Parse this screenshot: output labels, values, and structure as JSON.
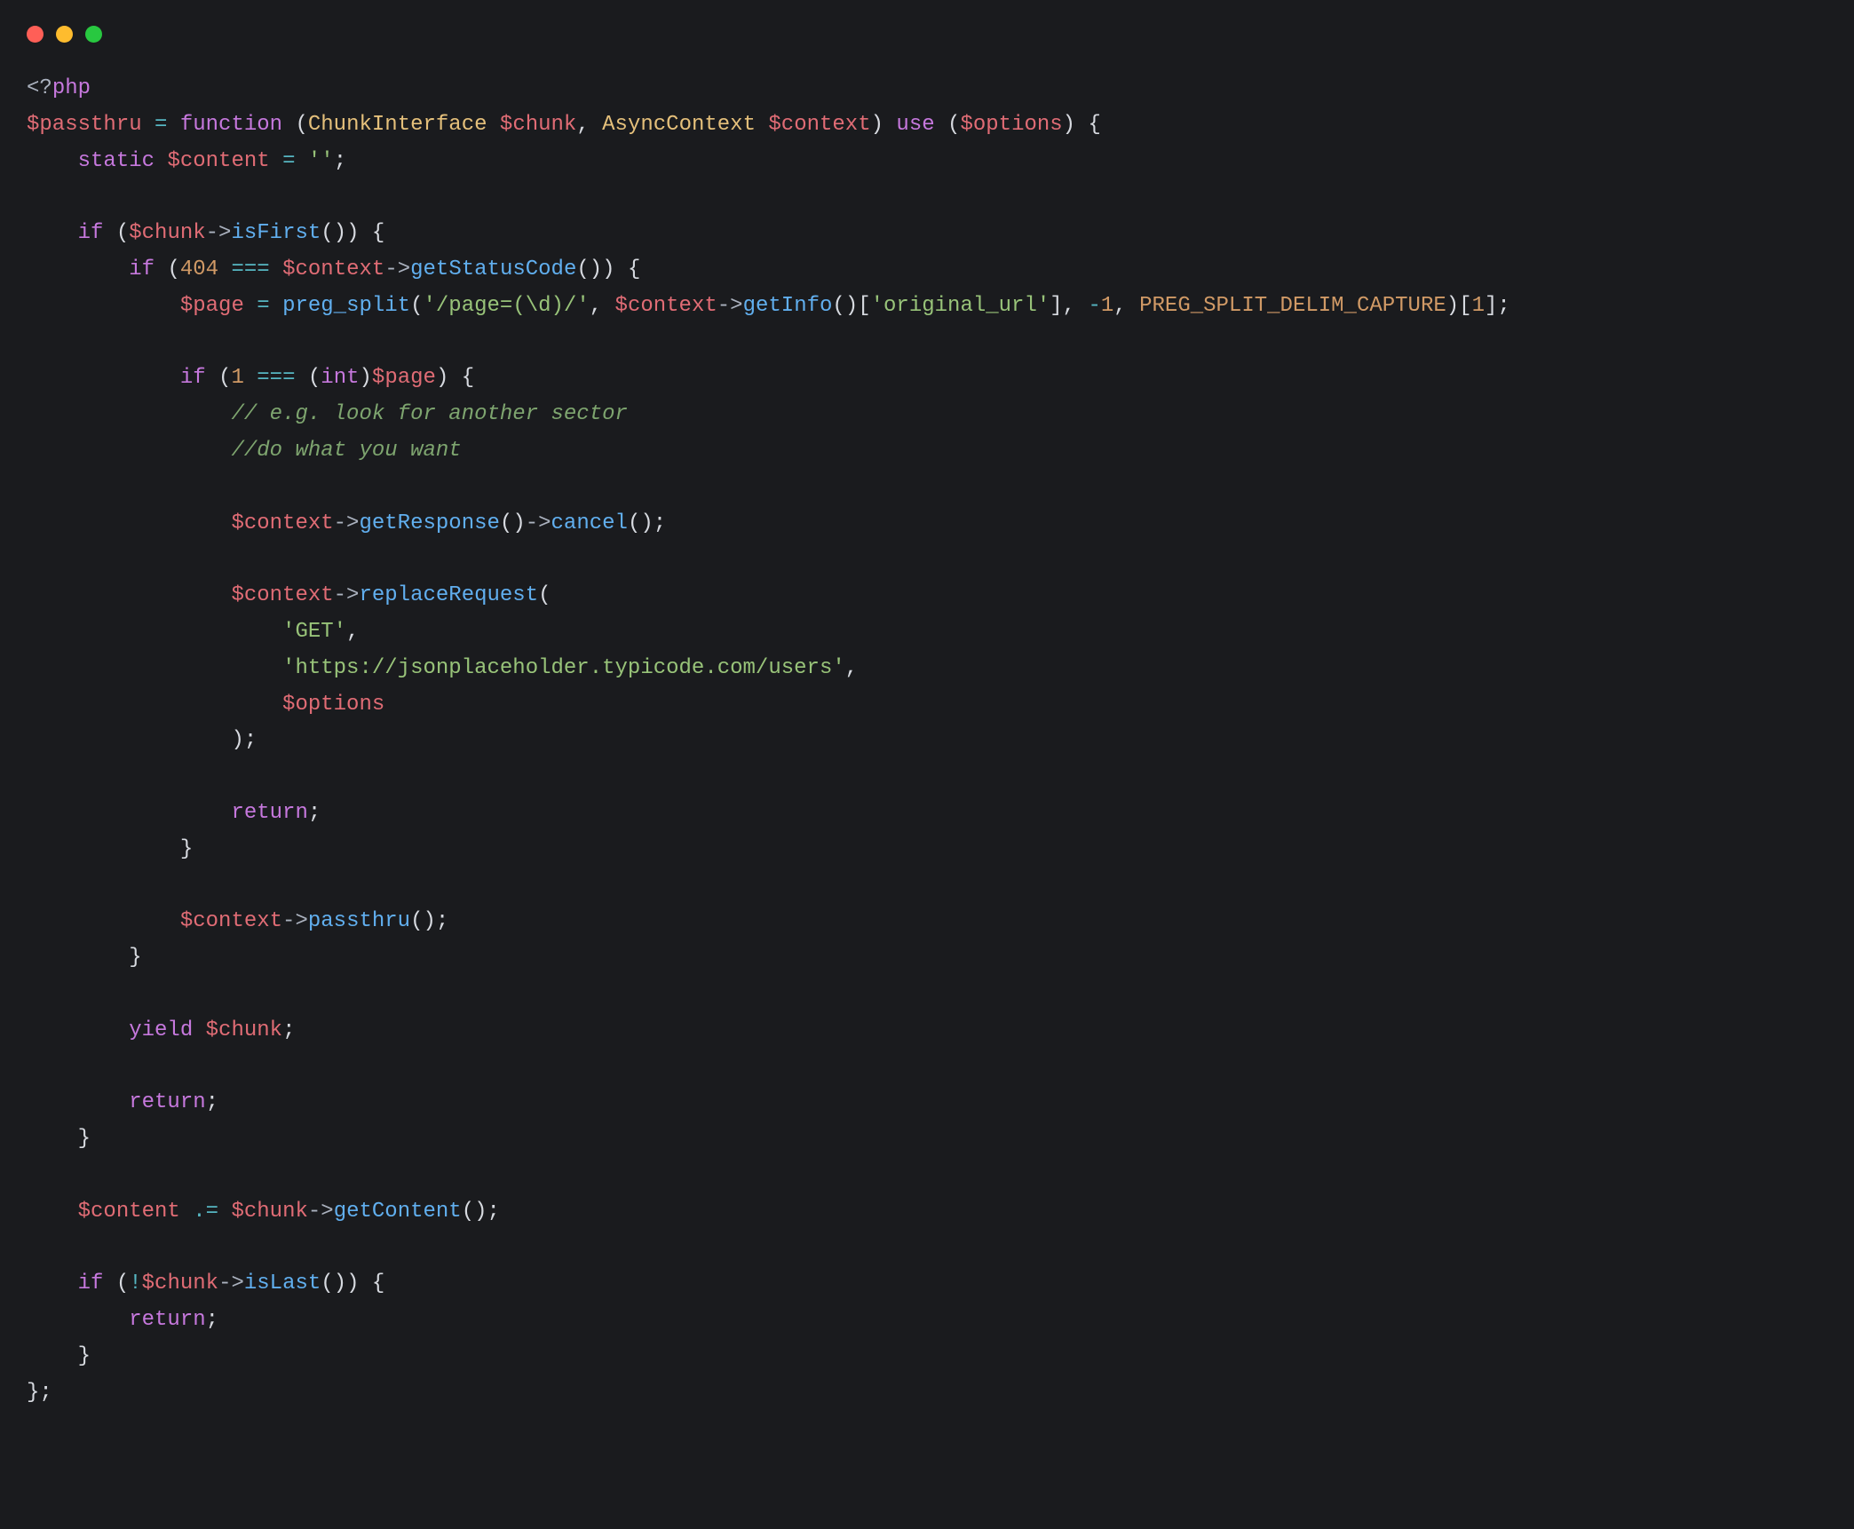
{
  "titlebar": {
    "dots": {
      "red": "#ff5f57",
      "yellow": "#febc2e",
      "green": "#28c840"
    }
  },
  "code": {
    "language": "php",
    "tokens": [
      [
        [
          "t-tag",
          "<?"
        ],
        [
          "t-kw",
          "php"
        ]
      ],
      [
        [
          "t-var",
          "$passthru"
        ],
        [
          "t-misc",
          " "
        ],
        [
          "t-op",
          "="
        ],
        [
          "t-misc",
          " "
        ],
        [
          "t-kw",
          "function"
        ],
        [
          "t-misc",
          " "
        ],
        [
          "t-punct",
          "("
        ],
        [
          "t-type",
          "ChunkInterface"
        ],
        [
          "t-misc",
          " "
        ],
        [
          "t-var",
          "$chunk"
        ],
        [
          "t-punct",
          ","
        ],
        [
          "t-misc",
          " "
        ],
        [
          "t-type",
          "AsyncContext"
        ],
        [
          "t-misc",
          " "
        ],
        [
          "t-var",
          "$context"
        ],
        [
          "t-punct",
          ")"
        ],
        [
          "t-misc",
          " "
        ],
        [
          "t-kw",
          "use"
        ],
        [
          "t-misc",
          " "
        ],
        [
          "t-punct",
          "("
        ],
        [
          "t-var",
          "$options"
        ],
        [
          "t-punct",
          ")"
        ],
        [
          "t-misc",
          " "
        ],
        [
          "t-punct",
          "{"
        ]
      ],
      [
        [
          "t-misc",
          "    "
        ],
        [
          "t-kw",
          "static"
        ],
        [
          "t-misc",
          " "
        ],
        [
          "t-var",
          "$content"
        ],
        [
          "t-misc",
          " "
        ],
        [
          "t-op",
          "="
        ],
        [
          "t-misc",
          " "
        ],
        [
          "t-str",
          "''"
        ],
        [
          "t-punct",
          ";"
        ]
      ],
      [],
      [
        [
          "t-misc",
          "    "
        ],
        [
          "t-kw",
          "if"
        ],
        [
          "t-misc",
          " "
        ],
        [
          "t-punct",
          "("
        ],
        [
          "t-var",
          "$chunk"
        ],
        [
          "t-arrow",
          "->"
        ],
        [
          "t-func",
          "isFirst"
        ],
        [
          "t-punct",
          "("
        ],
        [
          "t-punct",
          ")"
        ],
        [
          "t-punct",
          ")"
        ],
        [
          "t-misc",
          " "
        ],
        [
          "t-punct",
          "{"
        ]
      ],
      [
        [
          "t-misc",
          "        "
        ],
        [
          "t-kw",
          "if"
        ],
        [
          "t-misc",
          " "
        ],
        [
          "t-punct",
          "("
        ],
        [
          "t-num",
          "404"
        ],
        [
          "t-misc",
          " "
        ],
        [
          "t-op",
          "==="
        ],
        [
          "t-misc",
          " "
        ],
        [
          "t-var",
          "$context"
        ],
        [
          "t-arrow",
          "->"
        ],
        [
          "t-func",
          "getStatusCode"
        ],
        [
          "t-punct",
          "("
        ],
        [
          "t-punct",
          ")"
        ],
        [
          "t-punct",
          ")"
        ],
        [
          "t-misc",
          " "
        ],
        [
          "t-punct",
          "{"
        ]
      ],
      [
        [
          "t-misc",
          "            "
        ],
        [
          "t-var",
          "$page"
        ],
        [
          "t-misc",
          " "
        ],
        [
          "t-op",
          "="
        ],
        [
          "t-misc",
          " "
        ],
        [
          "t-func",
          "preg_split"
        ],
        [
          "t-punct",
          "("
        ],
        [
          "t-str",
          "'/page=(\\d)/'"
        ],
        [
          "t-punct",
          ","
        ],
        [
          "t-misc",
          " "
        ],
        [
          "t-var",
          "$context"
        ],
        [
          "t-arrow",
          "->"
        ],
        [
          "t-func",
          "getInfo"
        ],
        [
          "t-punct",
          "("
        ],
        [
          "t-punct",
          ")"
        ],
        [
          "t-punct",
          "["
        ],
        [
          "t-str",
          "'original_url'"
        ],
        [
          "t-punct",
          "]"
        ],
        [
          "t-punct",
          ","
        ],
        [
          "t-misc",
          " "
        ],
        [
          "t-op",
          "-"
        ],
        [
          "t-num",
          "1"
        ],
        [
          "t-punct",
          ","
        ],
        [
          "t-misc",
          " "
        ],
        [
          "t-const",
          "PREG_SPLIT_DELIM_CAPTURE"
        ],
        [
          "t-punct",
          ")"
        ],
        [
          "t-punct",
          "["
        ],
        [
          "t-num",
          "1"
        ],
        [
          "t-punct",
          "]"
        ],
        [
          "t-punct",
          ";"
        ]
      ],
      [],
      [
        [
          "t-misc",
          "            "
        ],
        [
          "t-kw",
          "if"
        ],
        [
          "t-misc",
          " "
        ],
        [
          "t-punct",
          "("
        ],
        [
          "t-num",
          "1"
        ],
        [
          "t-misc",
          " "
        ],
        [
          "t-op",
          "==="
        ],
        [
          "t-misc",
          " "
        ],
        [
          "t-punct",
          "("
        ],
        [
          "t-kw",
          "int"
        ],
        [
          "t-punct",
          ")"
        ],
        [
          "t-var",
          "$page"
        ],
        [
          "t-punct",
          ")"
        ],
        [
          "t-misc",
          " "
        ],
        [
          "t-punct",
          "{"
        ]
      ],
      [
        [
          "t-misc",
          "                "
        ],
        [
          "t-comment",
          "// e.g. look for another sector"
        ]
      ],
      [
        [
          "t-misc",
          "                "
        ],
        [
          "t-comment",
          "//do what you want"
        ]
      ],
      [],
      [
        [
          "t-misc",
          "                "
        ],
        [
          "t-var",
          "$context"
        ],
        [
          "t-arrow",
          "->"
        ],
        [
          "t-func",
          "getResponse"
        ],
        [
          "t-punct",
          "("
        ],
        [
          "t-punct",
          ")"
        ],
        [
          "t-arrow",
          "->"
        ],
        [
          "t-func",
          "cancel"
        ],
        [
          "t-punct",
          "("
        ],
        [
          "t-punct",
          ")"
        ],
        [
          "t-punct",
          ";"
        ]
      ],
      [],
      [
        [
          "t-misc",
          "                "
        ],
        [
          "t-var",
          "$context"
        ],
        [
          "t-arrow",
          "->"
        ],
        [
          "t-func",
          "replaceRequest"
        ],
        [
          "t-punct",
          "("
        ]
      ],
      [
        [
          "t-misc",
          "                    "
        ],
        [
          "t-str",
          "'GET'"
        ],
        [
          "t-punct",
          ","
        ]
      ],
      [
        [
          "t-misc",
          "                    "
        ],
        [
          "t-str",
          "'https://jsonplaceholder.typicode.com/users'"
        ],
        [
          "t-punct",
          ","
        ]
      ],
      [
        [
          "t-misc",
          "                    "
        ],
        [
          "t-var",
          "$options"
        ]
      ],
      [
        [
          "t-misc",
          "                "
        ],
        [
          "t-punct",
          ")"
        ],
        [
          "t-punct",
          ";"
        ]
      ],
      [],
      [
        [
          "t-misc",
          "                "
        ],
        [
          "t-kw",
          "return"
        ],
        [
          "t-punct",
          ";"
        ]
      ],
      [
        [
          "t-misc",
          "            "
        ],
        [
          "t-punct",
          "}"
        ]
      ],
      [],
      [
        [
          "t-misc",
          "            "
        ],
        [
          "t-var",
          "$context"
        ],
        [
          "t-arrow",
          "->"
        ],
        [
          "t-func",
          "passthru"
        ],
        [
          "t-punct",
          "("
        ],
        [
          "t-punct",
          ")"
        ],
        [
          "t-punct",
          ";"
        ]
      ],
      [
        [
          "t-misc",
          "        "
        ],
        [
          "t-punct",
          "}"
        ]
      ],
      [],
      [
        [
          "t-misc",
          "        "
        ],
        [
          "t-kw",
          "yield"
        ],
        [
          "t-misc",
          " "
        ],
        [
          "t-var",
          "$chunk"
        ],
        [
          "t-punct",
          ";"
        ]
      ],
      [],
      [
        [
          "t-misc",
          "        "
        ],
        [
          "t-kw",
          "return"
        ],
        [
          "t-punct",
          ";"
        ]
      ],
      [
        [
          "t-misc",
          "    "
        ],
        [
          "t-punct",
          "}"
        ]
      ],
      [],
      [
        [
          "t-misc",
          "    "
        ],
        [
          "t-var",
          "$content"
        ],
        [
          "t-misc",
          " "
        ],
        [
          "t-op",
          ".="
        ],
        [
          "t-misc",
          " "
        ],
        [
          "t-var",
          "$chunk"
        ],
        [
          "t-arrow",
          "->"
        ],
        [
          "t-func",
          "getContent"
        ],
        [
          "t-punct",
          "("
        ],
        [
          "t-punct",
          ")"
        ],
        [
          "t-punct",
          ";"
        ]
      ],
      [],
      [
        [
          "t-misc",
          "    "
        ],
        [
          "t-kw",
          "if"
        ],
        [
          "t-misc",
          " "
        ],
        [
          "t-punct",
          "("
        ],
        [
          "t-op",
          "!"
        ],
        [
          "t-var",
          "$chunk"
        ],
        [
          "t-arrow",
          "->"
        ],
        [
          "t-func",
          "isLast"
        ],
        [
          "t-punct",
          "("
        ],
        [
          "t-punct",
          ")"
        ],
        [
          "t-punct",
          ")"
        ],
        [
          "t-misc",
          " "
        ],
        [
          "t-punct",
          "{"
        ]
      ],
      [
        [
          "t-misc",
          "        "
        ],
        [
          "t-kw",
          "return"
        ],
        [
          "t-punct",
          ";"
        ]
      ],
      [
        [
          "t-misc",
          "    "
        ],
        [
          "t-punct",
          "}"
        ]
      ],
      [
        [
          "t-punct",
          "}"
        ],
        [
          "t-punct",
          ";"
        ]
      ]
    ]
  }
}
